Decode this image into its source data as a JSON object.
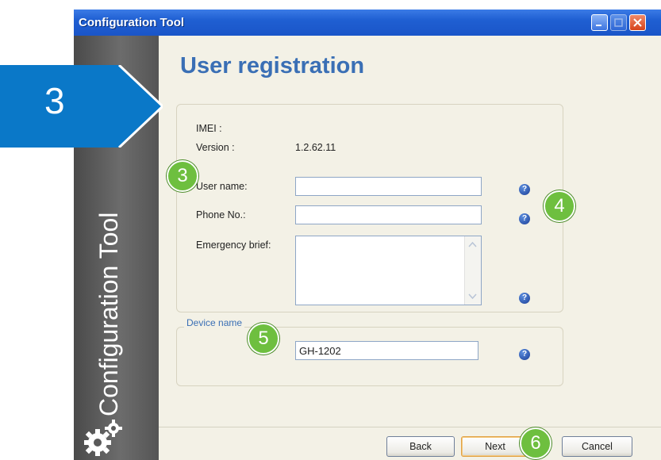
{
  "window": {
    "title": "Configuration Tool"
  },
  "sidebar": {
    "vertical_text": "Configuration Tool",
    "icon": "gears-icon"
  },
  "page": {
    "title": "User registration"
  },
  "info": {
    "imei_label": "IMEI :",
    "version_label": "Version :",
    "version_value": "1.2.62.11"
  },
  "form": {
    "user_name_label": "User name:",
    "user_name_value": "",
    "phone_label": "Phone No.:",
    "phone_value": "",
    "emergency_label": "Emergency brief:",
    "emergency_value": "",
    "help_glyph": "?"
  },
  "device": {
    "legend": "Device name",
    "value": "GH-1202"
  },
  "buttons": {
    "back": "Back",
    "next": "Next",
    "cancel": "Cancel"
  },
  "annotations": {
    "step": "3",
    "badge_user": "3",
    "badge_help": "4",
    "badge_device": "5",
    "badge_next": "6"
  },
  "colors": {
    "accent_blue": "#0a78c8",
    "badge_green": "#6ebf3f",
    "title_blue": "#3a6fb5"
  }
}
